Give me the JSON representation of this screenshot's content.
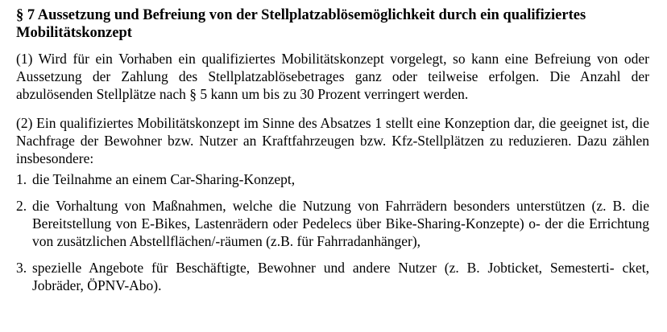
{
  "document": {
    "heading": "§ 7  Aussetzung und Befreiung von der Stellplatzablösemöglichkeit durch ein qualifiziertes Mobilitätskonzept",
    "paragraph1": "(1)  Wird für ein Vorhaben ein qualifiziertes Mobilitätskonzept vorgelegt, so kann eine Befreiung von oder Aussetzung der Zahlung des Stellplatzablösebetrages ganz oder teilweise erfolgen. Die Anzahl der abzulösenden Stellplätze nach § 5 kann um bis zu 30 Prozent verringert werden.",
    "paragraph2": "(2)  Ein qualifiziertes Mobilitätskonzept im Sinne des Absatzes 1 stellt eine Konzeption dar, die geeignet ist, die Nachfrage der Bewohner bzw. Nutzer an Kraftfahrzeugen bzw. Kfz-Stellplätzen zu reduzieren. Dazu zählen insbesondere:",
    "list": [
      {
        "num": "1.",
        "text": "die Teilnahme an einem Car-Sharing-Konzept,"
      },
      {
        "num": "2.",
        "text": "die Vorhaltung von Maßnahmen, welche die Nutzung von Fahrrädern besonders unterstützen (z. B. die Bereitstellung von E-Bikes, Lastenrädern oder Pedelecs über Bike-Sharing-Konzepte) o- der die Errichtung von zusätzlichen Abstellflächen/-räumen (z.B. für Fahrradanhänger),"
      },
      {
        "num": "3.",
        "text": "spezielle Angebote für Beschäftigte, Bewohner und andere Nutzer (z. B. Jobticket, Semesterti- cket, Jobräder, ÖPNV-Abo)."
      }
    ]
  }
}
